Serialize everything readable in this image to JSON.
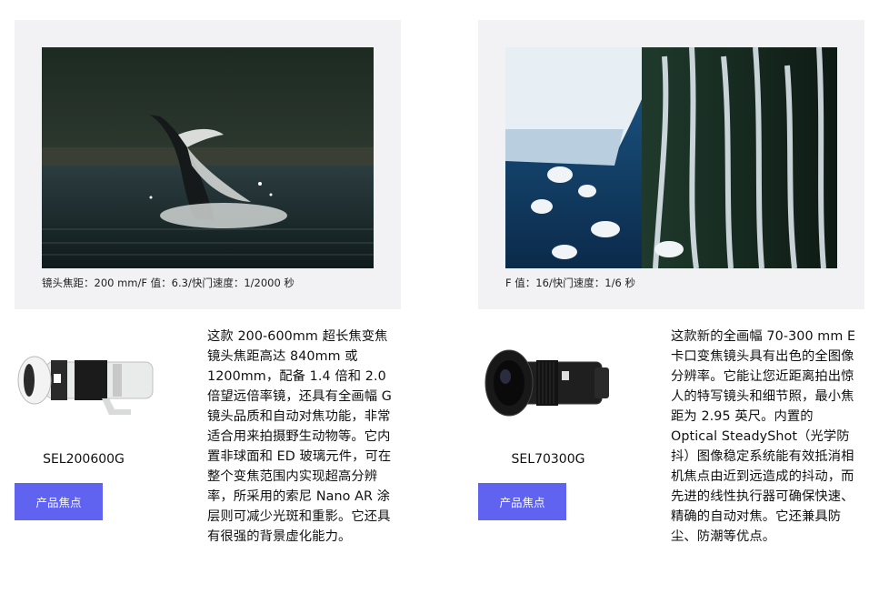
{
  "products": [
    {
      "caption": "镜头焦距：200 mm/F 值：6.3/快门速度：1/2000 秒",
      "model": "SEL200600G",
      "button_label": "产品焦点",
      "description": "这款 200-600mm 超长焦变焦镜头焦距高达 840mm 或 1200mm，配备 1.4 倍和 2.0 倍望远倍率镜，还具有全画幅 G 镜头品质和自动对焦功能，非常适合用来拍摄野生动物等。它内置非球面和 ED 玻璃元件，可在整个变焦范围内实现超高分辨率，所采用的索尼 Nano AR 涂层则可减少光斑和重影。它还具有很强的背景虚化能力。"
    },
    {
      "caption": "F 值：16/快门速度：1/6 秒",
      "model": "SEL70300G",
      "button_label": "产品焦点",
      "description": "这款新的全画幅 70-300 mm E 卡口变焦镜头具有出色的全图像分辨率。它能让您近距离拍出惊人的特写镜头和细节照，最小焦距为 2.95 英尺。内置的 Optical SteadyShot（光学防抖）图像稳定系统能有效抵消相机焦点由近到远造成的抖动，而先进的线性执行器可确保快速、精确的自动对焦。它还兼具防尘、防潮等优点。"
    }
  ],
  "colors": {
    "button": "#5f63f0",
    "card_bg": "#f2f2f4"
  }
}
